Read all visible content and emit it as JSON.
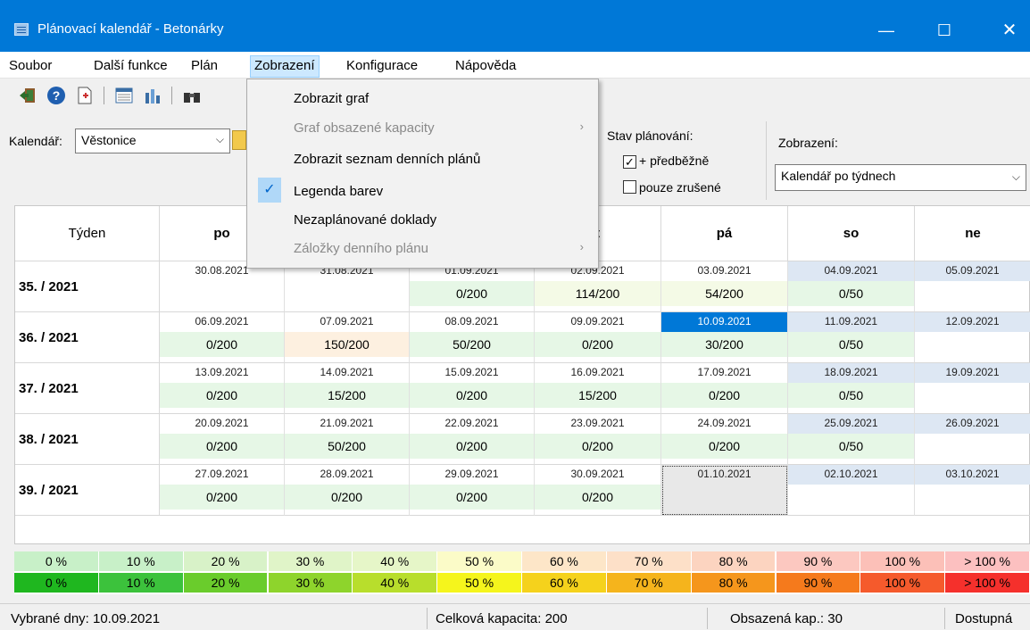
{
  "window": {
    "title": "Plánovací kalendář - Betonárky",
    "minimize": "—",
    "maximize": "☐",
    "close": "✕"
  },
  "menubar": [
    {
      "label": "Soubor"
    },
    {
      "label": "Další funkce"
    },
    {
      "label": "Plán"
    },
    {
      "label": "Zobrazení"
    },
    {
      "label": "Konfigurace"
    },
    {
      "label": "Nápověda"
    }
  ],
  "toolbar": {
    "icons": [
      "exit-icon",
      "help-icon",
      "new-document-icon",
      "calendar-list-icon",
      "chart-icon",
      "binoculars-icon"
    ]
  },
  "filters": {
    "calendar_label": "Kalendář:",
    "calendar_value": "Věstonice",
    "planning_state_label": "Stav plánování:",
    "preliminary_label": "+ předběžně",
    "preliminary_checked": true,
    "cancelled_label": "pouze zrušené",
    "cancelled_checked": false,
    "view_label": "Zobrazení:",
    "view_value": "Kalendář po týdnech"
  },
  "dropdown": {
    "items": [
      {
        "label": "Zobrazit graf",
        "enabled": true
      },
      {
        "label": "Graf obsazené kapacity",
        "enabled": false,
        "submenu": true
      },
      {
        "label": "Zobrazit seznam denních plánů",
        "enabled": true
      },
      {
        "label": "Legenda barev",
        "enabled": true,
        "checked": true
      },
      {
        "label": "Nezaplánované doklady",
        "enabled": true
      },
      {
        "label": "Záložky denního plánu",
        "enabled": false,
        "submenu": true
      }
    ]
  },
  "grid": {
    "headers": [
      "Týden",
      "po",
      "",
      "",
      "t",
      "pá",
      "so",
      "ne"
    ],
    "weeks": [
      {
        "label": "35. / 2021",
        "days": [
          {
            "date": "30.08.2021",
            "cap": ""
          },
          {
            "date": "31.08.2021",
            "cap": ""
          },
          {
            "date": "01.09.2021",
            "cap": "0/200"
          },
          {
            "date": "02.09.2021",
            "cap": "114/200"
          },
          {
            "date": "03.09.2021",
            "cap": "54/200"
          },
          {
            "date": "04.09.2021",
            "cap": "0/50"
          },
          {
            "date": "05.09.2021",
            "cap": ""
          }
        ]
      },
      {
        "label": "36. / 2021",
        "days": [
          {
            "date": "06.09.2021",
            "cap": "0/200"
          },
          {
            "date": "07.09.2021",
            "cap": "150/200"
          },
          {
            "date": "08.09.2021",
            "cap": "50/200"
          },
          {
            "date": "09.09.2021",
            "cap": "0/200"
          },
          {
            "date": "10.09.2021",
            "cap": "30/200"
          },
          {
            "date": "11.09.2021",
            "cap": "0/50"
          },
          {
            "date": "12.09.2021",
            "cap": ""
          }
        ]
      },
      {
        "label": "37. / 2021",
        "days": [
          {
            "date": "13.09.2021",
            "cap": "0/200"
          },
          {
            "date": "14.09.2021",
            "cap": "15/200"
          },
          {
            "date": "15.09.2021",
            "cap": "0/200"
          },
          {
            "date": "16.09.2021",
            "cap": "15/200"
          },
          {
            "date": "17.09.2021",
            "cap": "0/200"
          },
          {
            "date": "18.09.2021",
            "cap": "0/50"
          },
          {
            "date": "19.09.2021",
            "cap": ""
          }
        ]
      },
      {
        "label": "38. / 2021",
        "days": [
          {
            "date": "20.09.2021",
            "cap": "0/200"
          },
          {
            "date": "21.09.2021",
            "cap": "50/200"
          },
          {
            "date": "22.09.2021",
            "cap": "0/200"
          },
          {
            "date": "23.09.2021",
            "cap": "0/200"
          },
          {
            "date": "24.09.2021",
            "cap": "0/200"
          },
          {
            "date": "25.09.2021",
            "cap": "0/50"
          },
          {
            "date": "26.09.2021",
            "cap": ""
          }
        ]
      },
      {
        "label": "39. / 2021",
        "days": [
          {
            "date": "27.09.2021",
            "cap": "0/200"
          },
          {
            "date": "28.09.2021",
            "cap": "0/200"
          },
          {
            "date": "29.09.2021",
            "cap": "0/200"
          },
          {
            "date": "30.09.2021",
            "cap": "0/200"
          },
          {
            "date": "01.10.2021",
            "cap": ""
          },
          {
            "date": "02.10.2021",
            "cap": ""
          },
          {
            "date": "03.10.2021",
            "cap": ""
          }
        ]
      }
    ]
  },
  "legend": {
    "labels": [
      "0 %",
      "10 %",
      "20 %",
      "30 %",
      "40 %",
      "50 %",
      "60 %",
      "70 %",
      "80 %",
      "90 %",
      "100 %",
      "> 100 %"
    ],
    "light_colors": [
      "#c8f0c8",
      "#c8f0c8",
      "#d8f2c8",
      "#e0f4c8",
      "#e6f6c8",
      "#fbfbc8",
      "#fde6c8",
      "#fde0c8",
      "#fcd4c0",
      "#fcc8c0",
      "#fcc0b8",
      "#fcc0c0"
    ],
    "dark_colors": [
      "#1fb71f",
      "#3cc23c",
      "#6acc2c",
      "#8ed42c",
      "#b8de2c",
      "#f5f51c",
      "#f5d21c",
      "#f5b41c",
      "#f5961c",
      "#f57a1c",
      "#f55a2c",
      "#f5302c"
    ]
  },
  "status": {
    "selected_days": "Vybrané dny: 10.09.2021",
    "total_capacity": "Celková kapacita: 200",
    "used_capacity": "Obsazená kap.: 30",
    "available": "Dostupná"
  }
}
